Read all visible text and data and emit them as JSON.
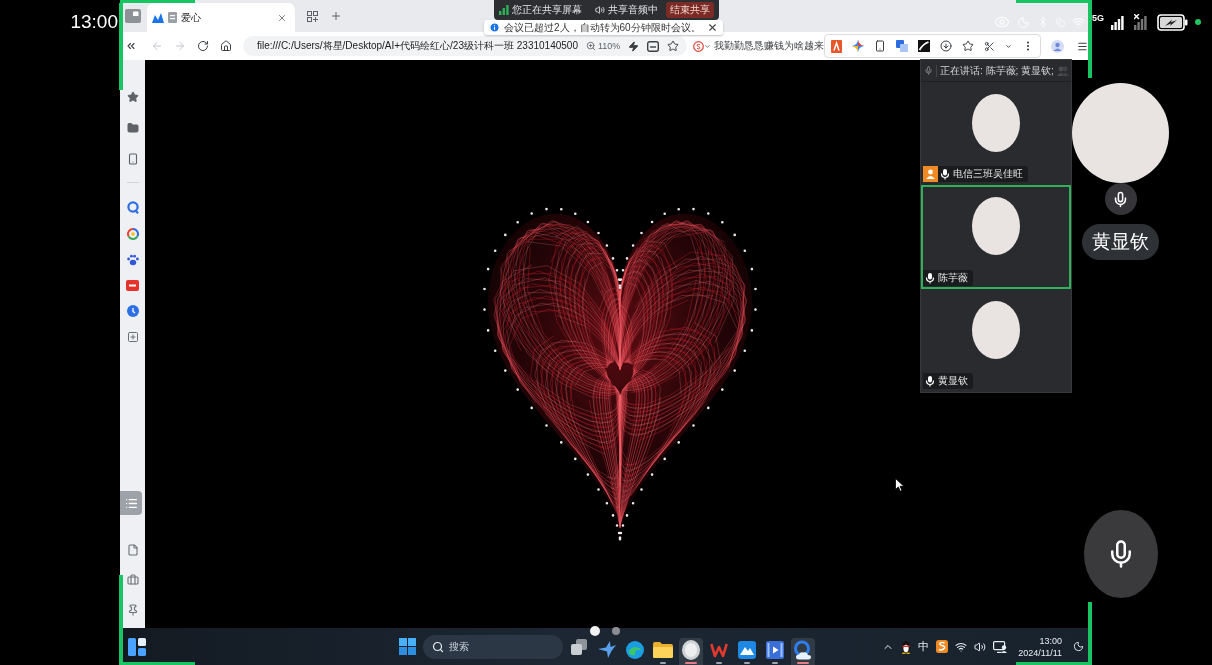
{
  "phone_status": {
    "time": "13:00",
    "network": "5G"
  },
  "screen_share": {
    "status": "您正在共享屏幕",
    "audio": "共享音频中",
    "stop_button": "结束共享"
  },
  "notice": {
    "text": "会议已超过2人，自动转为60分钟限时会议。"
  },
  "browser": {
    "tabs": [
      {
        "title": "爱心",
        "selected": true
      }
    ],
    "nav_buttons": [
      {
        "kind": "back",
        "disabled": true
      },
      {
        "kind": "forward",
        "disabled": true
      },
      {
        "kind": "reload",
        "disabled": false
      },
      {
        "kind": "home",
        "disabled": false
      }
    ],
    "address": "file:///C:/Users/将星/Desktop/AI+代码绘红心/23级计科一班 23310140500",
    "zoom": "110%",
    "bookmark": "我勤勤恳恳赚钱为啥越来"
  },
  "meeting_panel": {
    "speaking": "正在讲话: 陈芋薇; 黄显钦;",
    "participants": [
      {
        "name": "电信三班吴佳旺",
        "host": true,
        "selected": false
      },
      {
        "name": "陈芋薇",
        "host": false,
        "selected": true
      },
      {
        "name": "黄显钦",
        "host": false,
        "selected": false
      }
    ]
  },
  "pager": [
    {
      "selected": true
    },
    {
      "selected": false
    }
  ],
  "self_view": {
    "name": "黄显钦"
  },
  "taskbar": {
    "search": {
      "placeholder": "搜索"
    },
    "apps": [
      {
        "kind": "bird",
        "running": false,
        "active": false
      },
      {
        "kind": "edge",
        "running": false,
        "active": false
      },
      {
        "kind": "folder",
        "running": true,
        "active": false
      },
      {
        "kind": "disc",
        "running": true,
        "active": true
      },
      {
        "kind": "wps",
        "running": true,
        "active": false
      },
      {
        "kind": "mountain",
        "running": true,
        "active": false
      },
      {
        "kind": "video",
        "running": true,
        "active": false
      },
      {
        "kind": "cloud",
        "running": true,
        "active": true
      }
    ],
    "ime": "中",
    "time": "13:00",
    "date": "2024/11/11"
  }
}
